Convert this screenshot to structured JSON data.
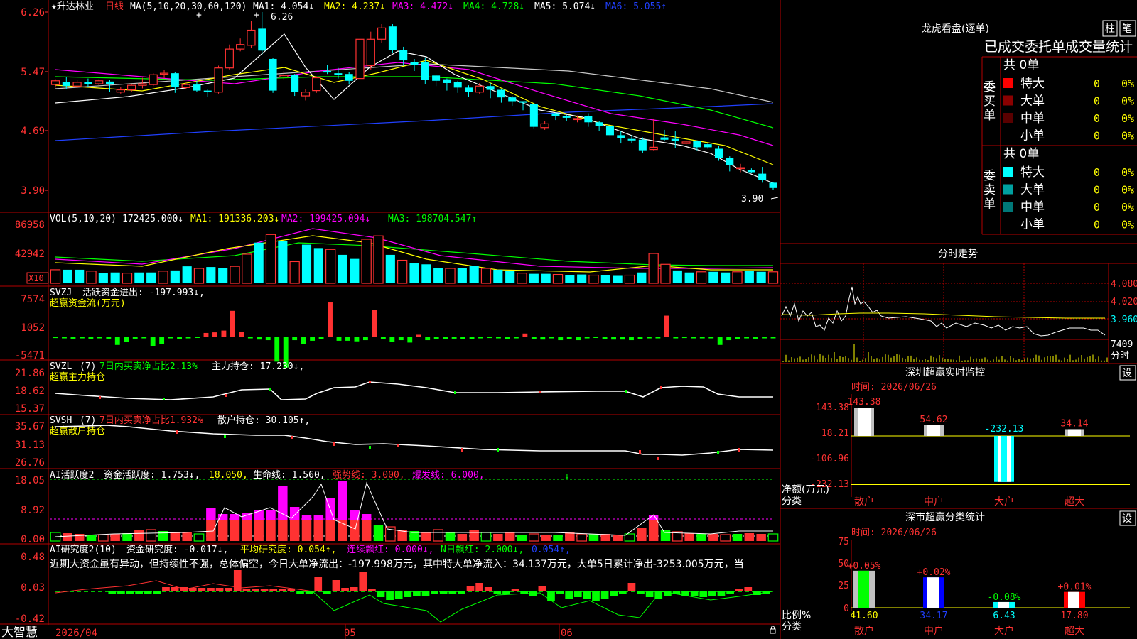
{
  "chart_data": [
    {
      "type": "candlestick",
      "title": "★升达林业",
      "period": "日线",
      "indicator": "MA(5,10,20,30,60,120)",
      "ma_labels": [
        "MA1: 4.054↓",
        "MA2: 4.237↓",
        "MA3: 4.472↓",
        "MA4: 4.728↓",
        "MA5: 5.074↓",
        "MA6: 5.055↑"
      ],
      "y_ticks": [
        "6.26",
        "5.47",
        "4.69",
        "3.90"
      ],
      "ylim": [
        3.9,
        6.26
      ],
      "high_label": "6.26",
      "low_label": "3.90",
      "candles": [
        [
          5.3,
          5.35,
          5.37,
          5.26
        ],
        [
          5.33,
          5.28,
          5.4,
          5.24
        ],
        [
          5.28,
          5.33,
          5.36,
          5.25
        ],
        [
          5.33,
          5.31,
          5.38,
          5.27
        ],
        [
          5.31,
          5.35,
          5.37,
          5.29
        ],
        [
          5.34,
          5.31,
          5.36,
          5.2
        ],
        [
          5.2,
          5.23,
          5.27,
          5.18
        ],
        [
          5.23,
          5.29,
          5.31,
          5.2
        ],
        [
          5.29,
          5.31,
          5.39,
          5.25
        ],
        [
          5.3,
          5.43,
          5.45,
          5.28
        ],
        [
          5.44,
          5.45,
          5.49,
          5.38
        ],
        [
          5.45,
          5.27,
          5.47,
          5.19
        ],
        [
          5.26,
          5.3,
          5.32,
          5.24
        ],
        [
          5.3,
          5.22,
          5.35,
          5.2
        ],
        [
          5.22,
          5.2,
          5.24,
          5.14
        ],
        [
          5.2,
          5.52,
          5.55,
          5.18
        ],
        [
          5.52,
          5.77,
          5.83,
          5.5
        ],
        [
          5.77,
          5.83,
          5.91,
          5.74
        ],
        [
          5.82,
          6.02,
          6.14,
          5.78
        ],
        [
          6.04,
          5.75,
          6.26,
          5.7
        ],
        [
          5.64,
          5.22,
          5.65,
          5.19
        ],
        [
          5.4,
          5.42,
          5.48,
          5.37
        ],
        [
          5.43,
          5.2,
          5.44,
          5.15
        ],
        [
          5.15,
          5.2,
          5.24,
          5.09
        ],
        [
          5.22,
          5.39,
          5.41,
          5.19
        ],
        [
          5.48,
          5.46,
          5.56,
          5.44
        ],
        [
          5.45,
          5.43,
          5.52,
          5.38
        ],
        [
          5.44,
          5.35,
          5.47,
          5.3
        ],
        [
          5.38,
          5.9,
          6.03,
          5.33
        ],
        [
          5.55,
          5.9,
          6.0,
          5.5
        ],
        [
          5.9,
          6.05,
          6.1,
          5.85
        ],
        [
          6.07,
          5.76,
          6.1,
          5.72
        ],
        [
          5.76,
          5.62,
          5.8,
          5.55
        ],
        [
          5.6,
          5.56,
          5.64,
          5.48
        ],
        [
          5.6,
          5.36,
          5.66,
          5.31
        ],
        [
          5.42,
          5.35,
          5.43,
          5.28
        ],
        [
          5.37,
          5.32,
          5.38,
          5.22
        ],
        [
          5.33,
          5.26,
          5.35,
          5.19
        ],
        [
          5.26,
          5.2,
          5.29,
          5.14
        ],
        [
          5.2,
          5.28,
          5.32,
          5.17
        ],
        [
          5.28,
          5.23,
          5.32,
          5.12
        ],
        [
          5.23,
          5.13,
          5.24,
          5.06
        ],
        [
          5.13,
          5.08,
          5.15,
          5.02
        ],
        [
          5.08,
          5.06,
          5.08,
          4.96
        ],
        [
          5.04,
          4.74,
          5.06,
          4.72
        ],
        [
          4.73,
          4.78,
          4.82,
          4.7
        ],
        [
          4.92,
          4.88,
          4.93,
          4.83
        ],
        [
          4.88,
          4.86,
          4.9,
          4.82
        ],
        [
          4.85,
          4.85,
          4.89,
          4.8
        ],
        [
          4.88,
          4.8,
          4.92,
          4.74
        ],
        [
          4.8,
          4.75,
          4.82,
          4.69
        ],
        [
          4.75,
          4.63,
          4.77,
          4.6
        ],
        [
          4.63,
          4.59,
          4.68,
          4.52
        ],
        [
          4.58,
          4.56,
          4.63,
          4.53
        ],
        [
          4.57,
          4.43,
          4.6,
          4.39
        ],
        [
          4.44,
          4.47,
          4.85,
          4.43
        ],
        [
          4.6,
          4.57,
          4.7,
          4.55
        ],
        [
          4.58,
          4.55,
          4.68,
          4.46
        ],
        [
          4.52,
          4.54,
          4.56,
          4.5
        ],
        [
          4.55,
          4.47,
          4.56,
          4.43
        ],
        [
          4.51,
          4.47,
          4.53,
          4.45
        ],
        [
          4.45,
          4.33,
          4.49,
          4.29
        ],
        [
          4.33,
          4.23,
          4.35,
          4.15
        ],
        [
          4.2,
          4.2,
          4.25,
          4.14
        ],
        [
          4.17,
          4.14,
          4.19,
          4.13
        ],
        [
          4.12,
          4.04,
          4.21,
          4.0
        ],
        [
          4.0,
          3.93,
          4.01,
          3.9
        ]
      ]
    },
    {
      "type": "bar",
      "title": "VOL(5,10,20)",
      "labels": [
        "172425.000↓",
        "MA1: 191336.203↓",
        "MA2: 199425.094↓",
        "MA3: 198704.547↑"
      ],
      "y_ticks": [
        "86958",
        "42942"
      ],
      "unit_badge": "X10",
      "ylim": [
        0,
        86958
      ],
      "values": [
        20000,
        20000,
        20000,
        18000,
        15000,
        16000,
        15000,
        16000,
        16000,
        18000,
        19000,
        25000,
        22000,
        24000,
        23000,
        25000,
        43000,
        60000,
        72000,
        62000,
        32000,
        57000,
        52000,
        50000,
        42000,
        36000,
        65000,
        70000,
        42000,
        34000,
        30000,
        28000,
        22000,
        22000,
        22000,
        26000,
        22000,
        20000,
        18000,
        15000,
        14000,
        14000,
        13000,
        12000,
        13000,
        12000,
        12000,
        11000,
        12000,
        16000,
        44000,
        28000,
        19000,
        16000,
        17000,
        17000,
        16000,
        17000,
        18000,
        17000,
        17000
      ]
    },
    {
      "type": "bar",
      "title": "SVZJ",
      "labels": [
        "活跃资金进出: -197.993↓,",
        "超赢资金流(万元)"
      ],
      "y_ticks": [
        "7574",
        "1052",
        "-5471"
      ],
      "ylim": [
        -5471,
        7574
      ],
      "values": [
        -250,
        -300,
        -350,
        -300,
        -350,
        -300,
        -350,
        -1400,
        -900,
        -350,
        -300,
        -1600,
        -1200,
        -300,
        -400,
        -300,
        -200,
        600,
        700,
        1000,
        4300,
        800,
        -300,
        -500,
        -600,
        -4200,
        -5200,
        -600,
        -1300,
        -700,
        -400,
        5700,
        -700,
        -700,
        -800,
        -600,
        4400,
        -400,
        -900,
        -600,
        -1000,
        300,
        -600,
        -400,
        -400,
        -350,
        -400,
        -400,
        -300,
        -250,
        -300,
        -400,
        -300,
        500,
        -400,
        -500,
        -300,
        -600,
        -400,
        -600,
        -300,
        -200,
        -400,
        -500,
        -500,
        -600,
        -400,
        -300,
        -300,
        3500,
        -300,
        -250,
        -300,
        -300,
        -300,
        -1400,
        -600,
        -400,
        -300,
        -350,
        -300,
        -300
      ]
    },
    {
      "type": "line",
      "title": "SVZL",
      "labels": [
        "(7)",
        "7日内买卖净占比2.13%",
        "主力持仓: 17.230↓,",
        "超赢主力持仓"
      ],
      "y_ticks": [
        "21.86",
        "18.62",
        "15.37"
      ],
      "ylim": [
        15.37,
        21.86
      ]
    },
    {
      "type": "line",
      "title": "SVSH",
      "labels": [
        "(7)",
        "7日内买卖净占比1.932%",
        "散户持仓: 30.105↑,",
        "超赢散户持仓"
      ],
      "y_ticks": [
        "35.67",
        "31.13",
        "26.76"
      ],
      "ylim": [
        26.76,
        35.67
      ]
    },
    {
      "type": "bar",
      "title": "AI活跃度2",
      "labels": [
        "资金活跃度: 1.753↓,",
        "18.050,",
        "生命线: 1.560,",
        "强势线: 3.000,",
        "爆发线: 6.000,"
      ],
      "y_ticks": [
        "18.05",
        "8.92",
        "0.00"
      ],
      "ylim": [
        0,
        18.05
      ]
    },
    {
      "type": "bar",
      "title": "AI研究度2(10)",
      "labels": [
        "资金研究度: -0.017↓,",
        "平均研究度: 0.054↑,",
        "连续飘红: 0.000↓,",
        "N日飘红: 2.000↓,",
        "0.054↑,"
      ],
      "commentary": "近期大资金虽有异动，但持续性不强，总体偏空，今日大单净流出：-197.998万元，其中特大单净流入：34.137万元，大单5日累计净出-3253.005万元，当",
      "y_ticks": [
        "0.48",
        "0.03",
        "-0.42"
      ],
      "ylim": [
        -0.42,
        0.48
      ]
    },
    {
      "type": "bar",
      "title": "深圳超赢实时监控",
      "date_label": "时间: 2026/06/26",
      "y_ticks": [
        "143.38",
        "18.21",
        "-106.96",
        "-232.13"
      ],
      "y_unit": "净额(万元)",
      "x_title": "分类",
      "categories": [
        "散户",
        "中户",
        "大户",
        "超大"
      ],
      "values": [
        143.38,
        54.62,
        -232.13,
        34.14
      ],
      "value_labels": [
        "143.38",
        "54.62",
        "-232.13",
        "34.14"
      ],
      "ylim": [
        -232.13,
        143.38
      ]
    },
    {
      "type": "bar",
      "title": "深市超赢分类统计",
      "date_label": "时间: 2026/06/26",
      "y_ticks": [
        "75",
        "50",
        "25",
        "0"
      ],
      "y_unit": "比例%",
      "x_title": "分类",
      "categories": [
        "散户",
        "中户",
        "大户",
        "超大"
      ],
      "values": [
        41.6,
        34.17,
        6.43,
        17.8
      ],
      "value_labels": [
        "41.60",
        "34.17",
        "6.43",
        "17.80"
      ],
      "change_labels": [
        "+0.05%",
        "+0.02%",
        "-0.08%",
        "+0.01%"
      ],
      "ylim": [
        0,
        75
      ]
    }
  ],
  "x_axis": {
    "labels": [
      "2026/04",
      "05",
      "06"
    ]
  },
  "brand": "大智慧",
  "right_panel": {
    "header": "龙虎看盘(逐单)",
    "buttons": [
      "柱",
      "笔"
    ],
    "title": "已成交委托单成交量统计",
    "buy": {
      "side_label": "委买单",
      "total": "共 0单",
      "rows": [
        {
          "label": "特大",
          "count": "0",
          "pct": "0%",
          "color": "#ff0000"
        },
        {
          "label": "大单",
          "count": "0",
          "pct": "0%",
          "color": "#8b0000"
        },
        {
          "label": "中单",
          "count": "0",
          "pct": "0%",
          "color": "#5a0000"
        },
        {
          "label": "小单",
          "count": "0",
          "pct": "0%",
          "color": "#000000"
        }
      ]
    },
    "sell": {
      "side_label": "委卖单",
      "total": "共 0单",
      "rows": [
        {
          "label": "特大",
          "count": "0",
          "pct": "0%",
          "color": "#00ffff"
        },
        {
          "label": "大单",
          "count": "0",
          "pct": "0%",
          "color": "#00a0a0"
        },
        {
          "label": "中单",
          "count": "0",
          "pct": "0%",
          "color": "#007878"
        },
        {
          "label": "小单",
          "count": "0",
          "pct": "0%",
          "color": "#000000"
        }
      ]
    },
    "intraday": {
      "title": "分时走势",
      "price_ticks": [
        "4.080",
        "4.020",
        "3.960"
      ],
      "vol_tick": "7409",
      "vol_unit": "分时"
    },
    "monitor_button": "设",
    "stats_button": "设"
  },
  "colors": {
    "up": "#ff3232",
    "down": "#00ffff",
    "grid": "#b40000",
    "magenta": "#ff00ff",
    "yellow": "#ffff00",
    "green": "#00ff00"
  }
}
